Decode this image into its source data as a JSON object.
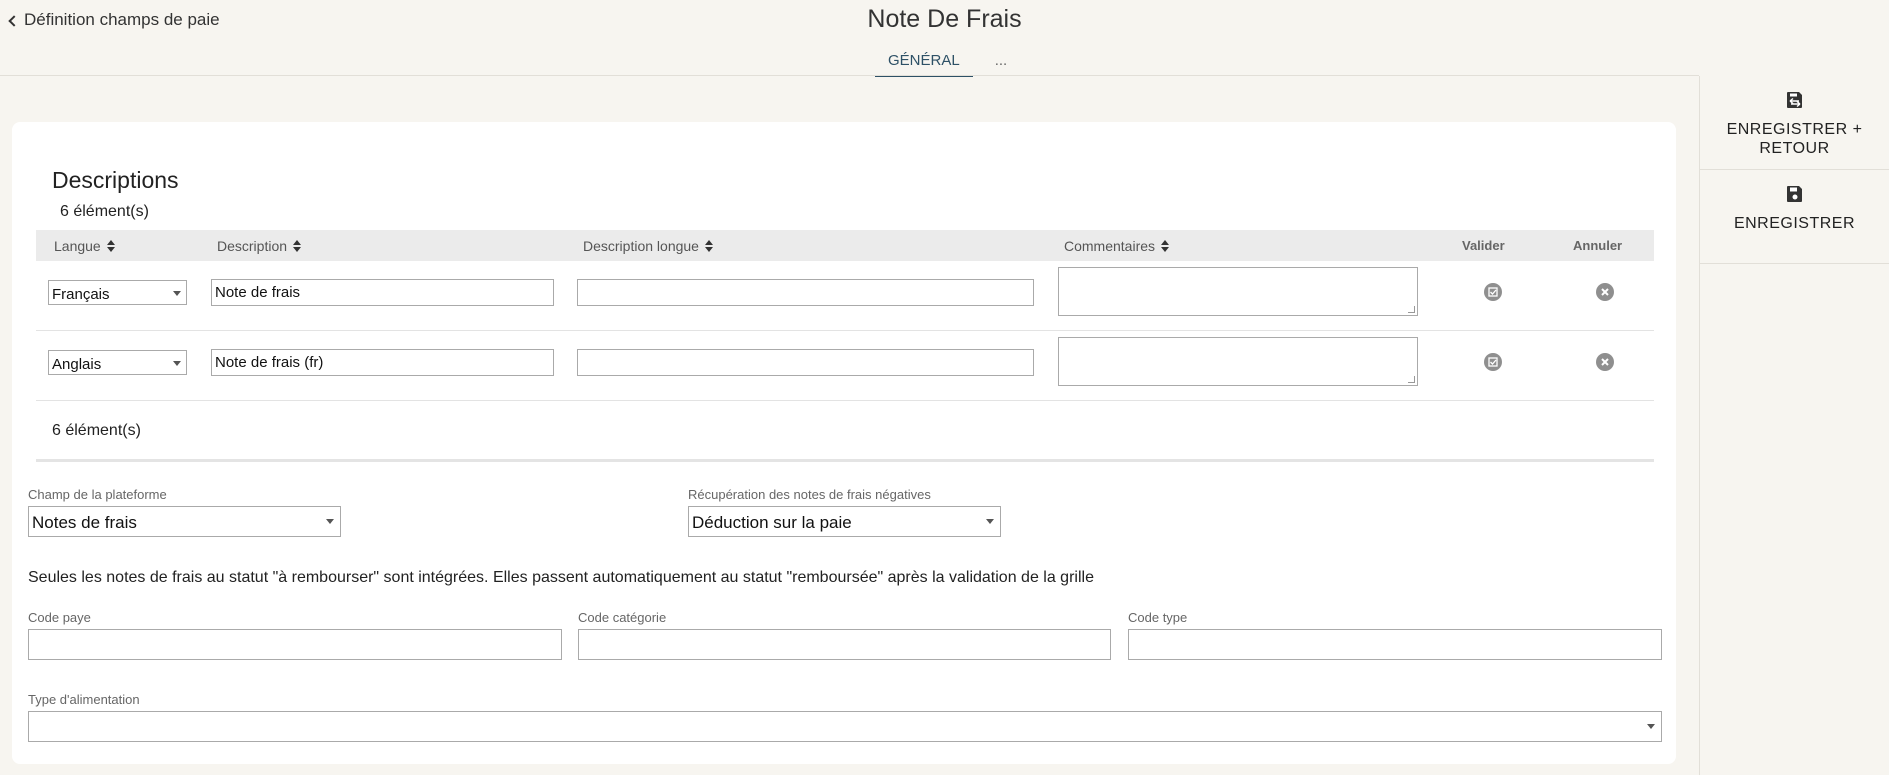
{
  "header": {
    "back_label": "Définition champs de paie",
    "title": "Note De Frais",
    "tabs": [
      {
        "label": "GÉNÉRAL",
        "active": true
      },
      {
        "label": "...",
        "active": false
      }
    ]
  },
  "actions": {
    "save_return_label": "ENREGISTRER + RETOUR",
    "save_label": "ENREGISTRER"
  },
  "descriptions": {
    "title": "Descriptions",
    "count_label": "6 élément(s)",
    "columns": {
      "langue": "Langue",
      "description": "Description",
      "description_longue": "Description longue",
      "commentaires": "Commentaires",
      "valider": "Valider",
      "annuler": "Annuler"
    },
    "rows": [
      {
        "langue": "Français",
        "description": "Note de frais",
        "description_longue": "",
        "commentaires": ""
      },
      {
        "langue": "Anglais",
        "description": "Note de frais (fr)",
        "description_longue": "",
        "commentaires": ""
      }
    ]
  },
  "form": {
    "champ_plateforme": {
      "label": "Champ de la plateforme",
      "value": "Notes de frais"
    },
    "recuperation": {
      "label": "Récupération des notes de frais négatives",
      "value": "Déduction sur la paie"
    },
    "info_text": "Seules les notes de frais au statut \"à rembourser\" sont intégrées. Elles passent automatiquement au statut \"remboursée\" après la validation de la grille",
    "code_paye": {
      "label": "Code paye",
      "value": ""
    },
    "code_categorie": {
      "label": "Code catégorie",
      "value": ""
    },
    "code_type": {
      "label": "Code type",
      "value": ""
    },
    "type_alimentation": {
      "label": "Type d'alimentation",
      "value": ""
    }
  },
  "colors": {
    "accent": "#2e5166",
    "background": "#f7f5f0",
    "icon_grey": "#8f8f8f"
  },
  "icons": {
    "back": "chevron-left-icon",
    "save_return": "save-return-icon",
    "save": "floppy-disk-icon",
    "sort": "sort-icon",
    "validate": "check-circle-icon",
    "cancel": "close-circle-icon"
  }
}
